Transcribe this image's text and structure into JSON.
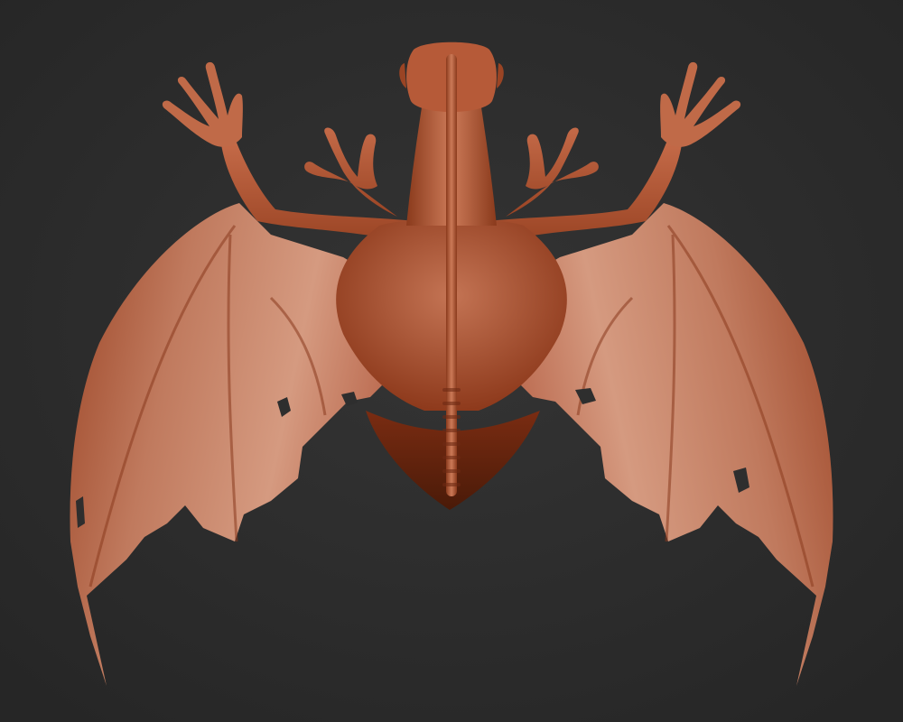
{
  "scene": {
    "subject": "winged-creature-sculpt",
    "view": "back",
    "colors": {
      "background": "#2e2e2e",
      "skin_light": "#d08a6e",
      "skin_mid": "#b65c3c",
      "skin_dark": "#6e2a14",
      "membrane": "#c98467",
      "shadow": "#3a1408"
    }
  }
}
